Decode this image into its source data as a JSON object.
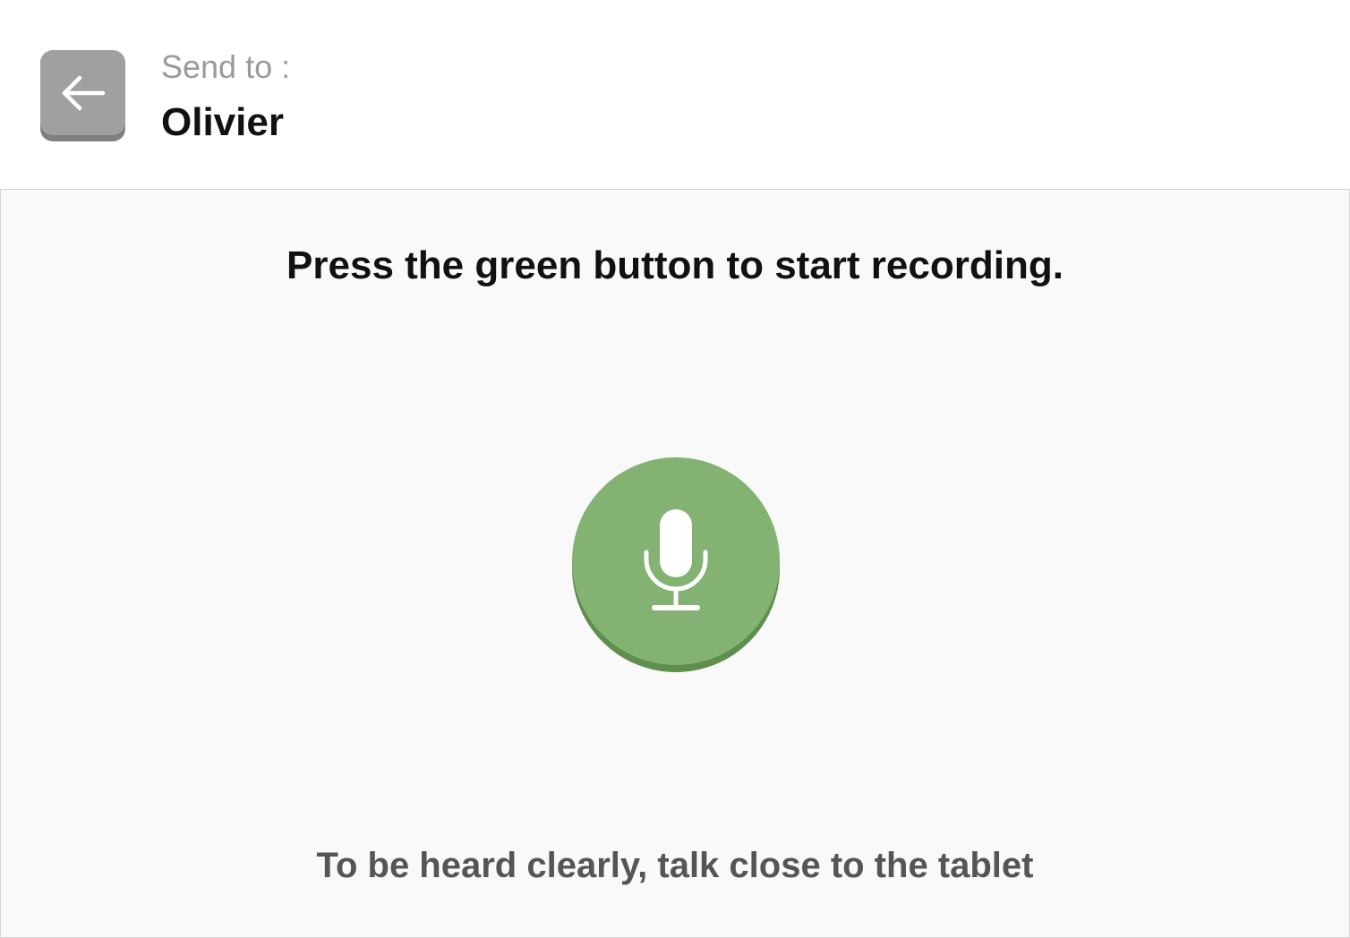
{
  "header": {
    "back_icon": "arrow-left-icon",
    "send_to_label": "Send to :",
    "recipient_name": "Olivier"
  },
  "main": {
    "instruction": "Press the green button to start recording.",
    "record_icon": "microphone-icon",
    "hint": "To be heard clearly, talk close to the tablet"
  },
  "colors": {
    "record_button": "#84b273",
    "back_button": "#a0a0a0",
    "panel_background": "#f9f9f9"
  }
}
